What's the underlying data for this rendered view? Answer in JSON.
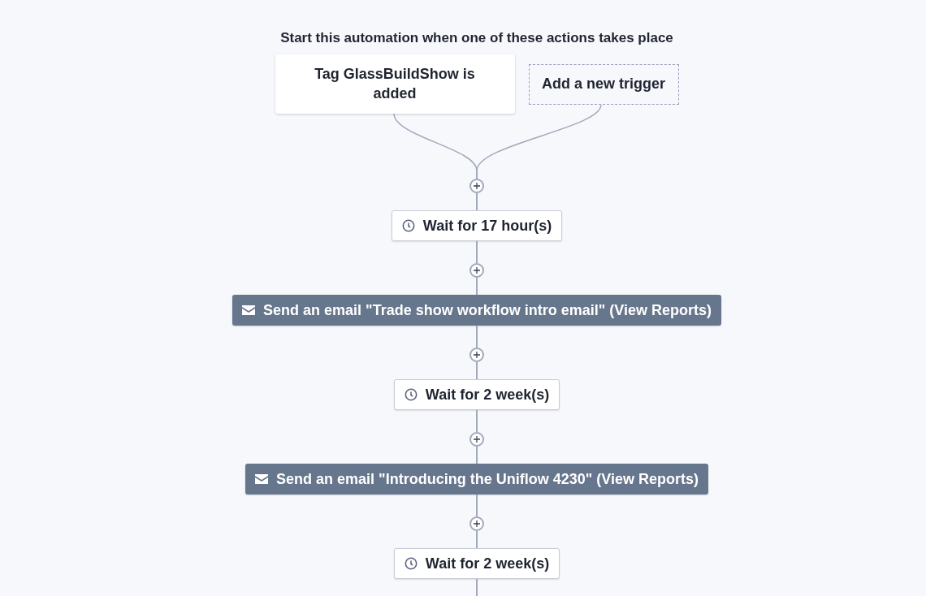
{
  "heading": "Start this automation when one of these actions takes place",
  "triggers": [
    {
      "kind": "trigger",
      "label": "Tag GlassBuildShow is added"
    },
    {
      "kind": "add",
      "label": "Add a new trigger"
    }
  ],
  "steps": [
    {
      "kind": "wait",
      "label": "Wait for 17 hour(s)"
    },
    {
      "kind": "email",
      "label": "Send an email \"Trade show workflow intro email\" (View Reports)"
    },
    {
      "kind": "wait",
      "label": "Wait for 2 week(s)"
    },
    {
      "kind": "email",
      "label": "Send an email \"Introducing the Uniflow 4230\" (View Reports)"
    },
    {
      "kind": "wait",
      "label": "Wait for 2 week(s)"
    }
  ]
}
